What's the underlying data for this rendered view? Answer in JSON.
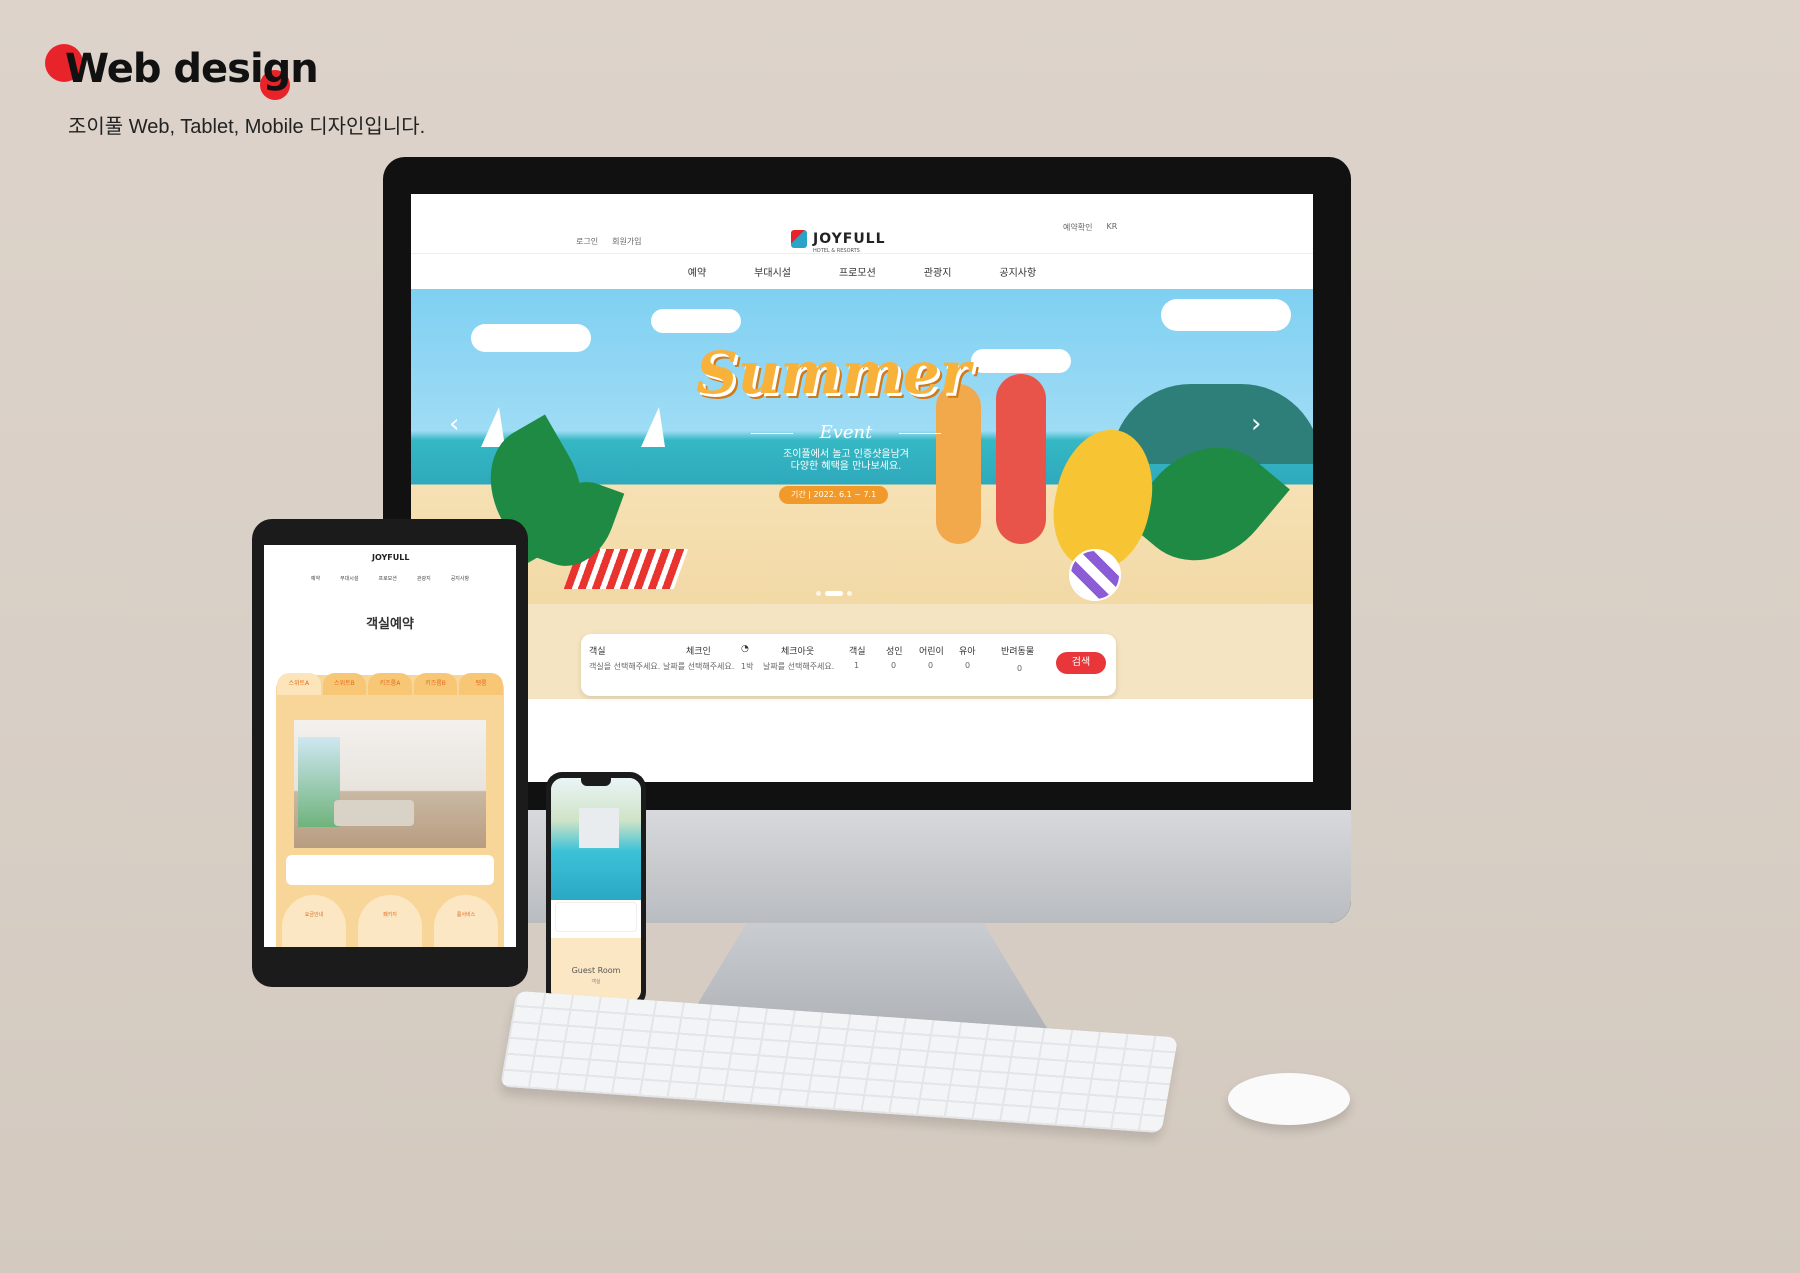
{
  "header": {
    "title": "Web design",
    "subtitle": "조이풀 Web, Tablet, Mobile 디자인입니다."
  },
  "desktop": {
    "util_left": [
      "로그인",
      "회원가입"
    ],
    "util_right": [
      "예약확인",
      "KR"
    ],
    "logo": "JOYFULL",
    "logo_sub": "HOTEL & RESORTS",
    "nav": [
      "예약",
      "부대시설",
      "프로모션",
      "관광지",
      "공지사항"
    ],
    "hero": {
      "headline": "Summer",
      "subhead": "Event",
      "copy_line1": "조이풀에서 놀고 인증샷을남겨",
      "copy_line2": "다양한 혜택을 만나보세요.",
      "period": "기간 | 2022. 6.1 ~ 7.1",
      "prev_icon": "chevron-left-icon",
      "next_icon": "chevron-right-icon"
    },
    "booking": {
      "room_label": "객실",
      "room_value": "객실을 선택해주세요.",
      "checkin_label": "체크인",
      "checkin_value": "날짜를 선택해주세요.",
      "nights_value": "1박",
      "checkout_label": "체크아웃",
      "checkout_value": "날짜를 선택해주세요.",
      "rooms_label": "객실",
      "rooms_value": "1",
      "adult_label": "성인",
      "adult_value": "0",
      "child_label": "어린이",
      "child_value": "0",
      "infant_label": "유아",
      "infant_value": "0",
      "pet_label": "반려동물",
      "pet_value": "0",
      "search_label": "검색"
    }
  },
  "tablet": {
    "logo": "JOYFULL",
    "title": "객실예약",
    "tabs": [
      "스위트A",
      "스위트B",
      "키즈룸A",
      "키즈룸B",
      "펫룸"
    ],
    "cards": [
      "요금안내",
      "패키지",
      "룸서비스"
    ]
  },
  "phone": {
    "guest_title": "Guest Room",
    "guest_sub": "객실"
  }
}
